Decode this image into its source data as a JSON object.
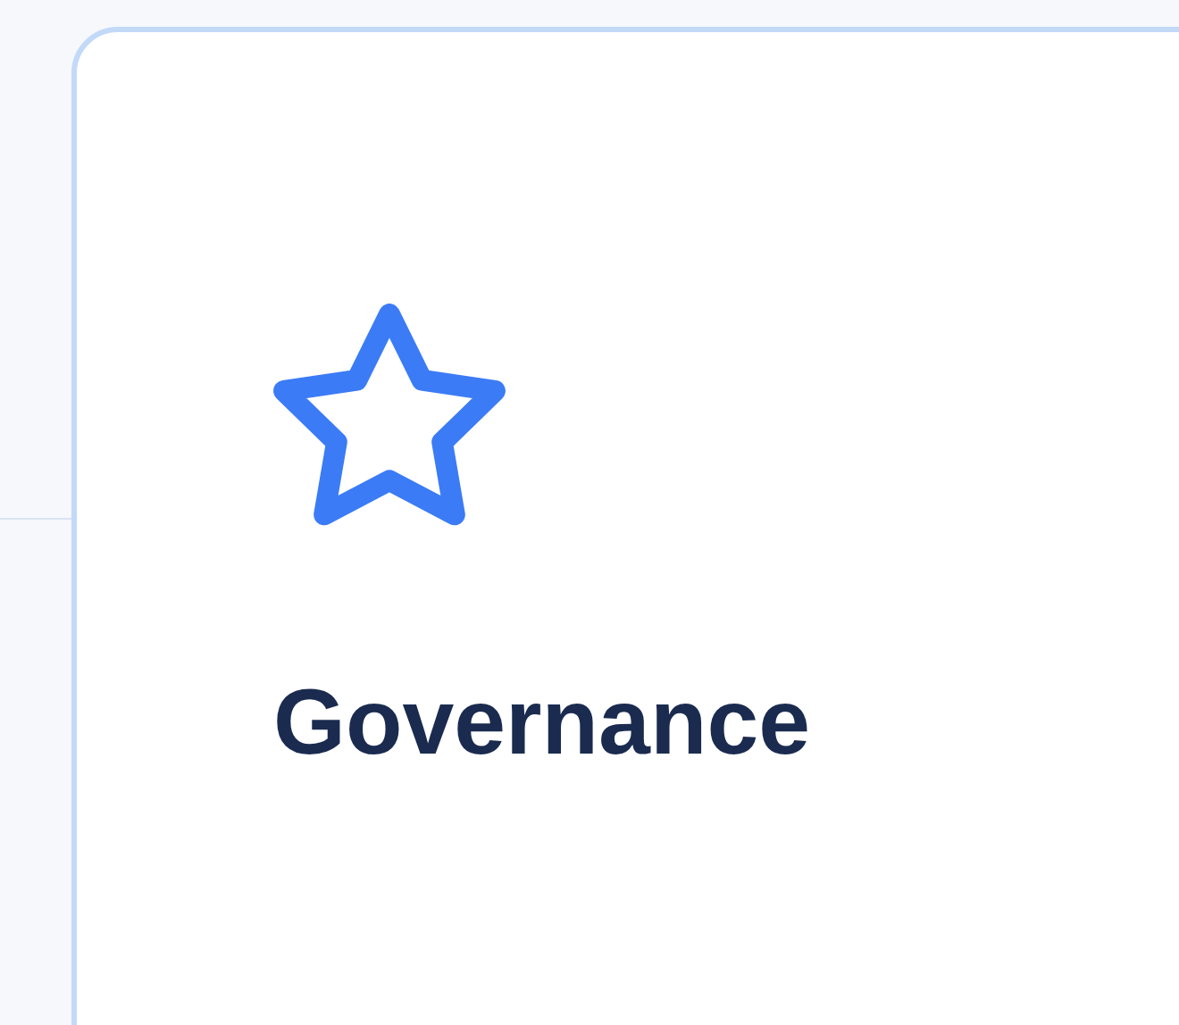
{
  "card": {
    "title": "Governance"
  }
}
